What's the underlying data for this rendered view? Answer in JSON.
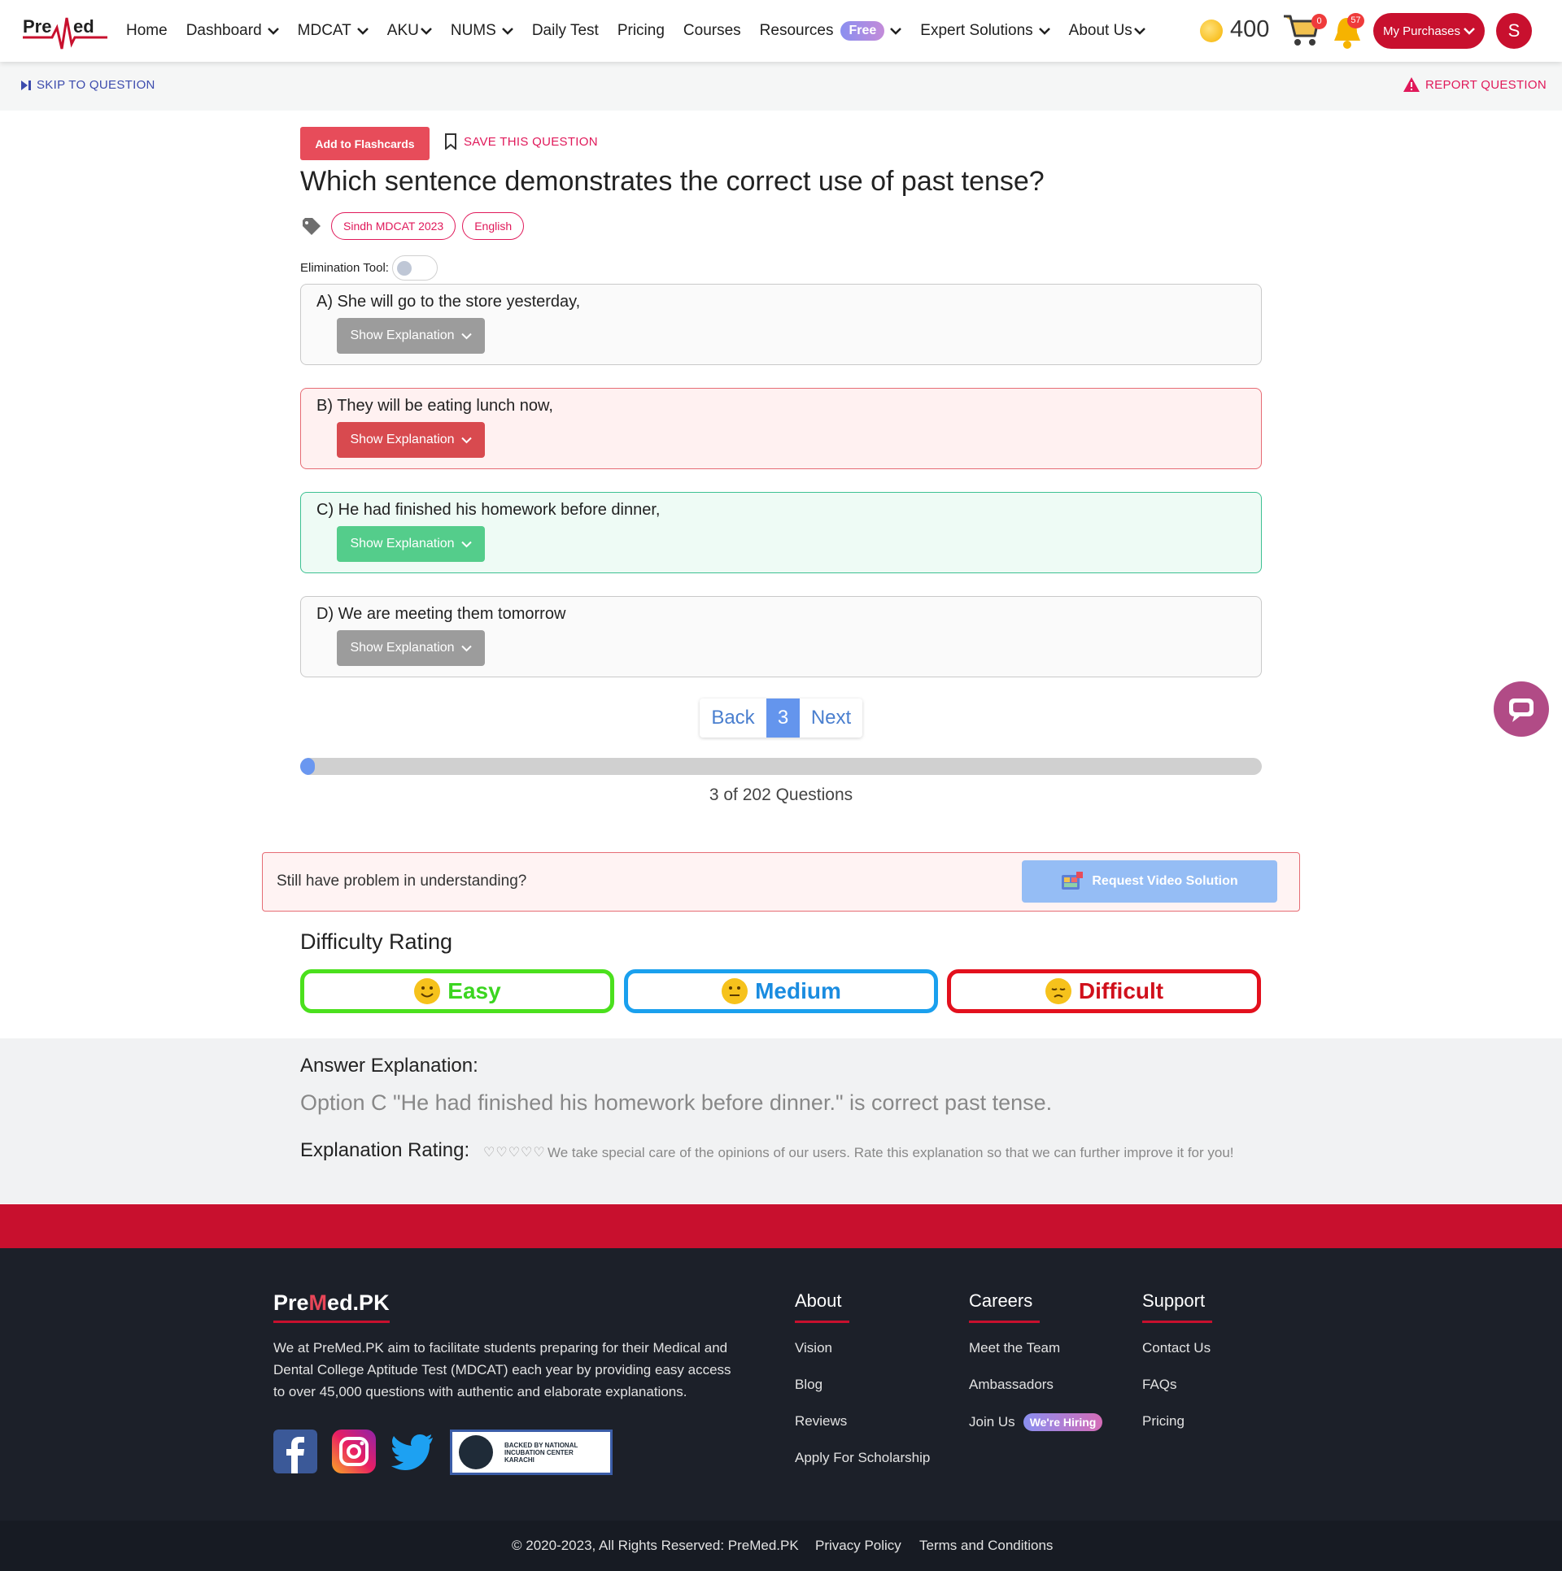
{
  "header": {
    "logo_text": "PreMed",
    "nav": [
      {
        "label": "Home",
        "has_dropdown": false
      },
      {
        "label": "Dashboard",
        "has_dropdown": true
      },
      {
        "label": "MDCAT",
        "has_dropdown": true
      },
      {
        "label": "AKU",
        "has_dropdown": true
      },
      {
        "label": "NUMS",
        "has_dropdown": true
      },
      {
        "label": "Daily Test",
        "has_dropdown": false
      },
      {
        "label": "Pricing",
        "has_dropdown": false
      },
      {
        "label": "Courses",
        "has_dropdown": false
      },
      {
        "label": "Resources",
        "badge": "Free",
        "has_dropdown": true
      },
      {
        "label": "Expert Solutions",
        "has_dropdown": true
      },
      {
        "label": "About Us",
        "has_dropdown": true
      }
    ],
    "coins": "400",
    "cart_count": "0",
    "notification_count": "57",
    "purchases_label": "My Purchases",
    "avatar_initial": "S"
  },
  "subbar": {
    "skip_label": "SKIP TO QUESTION",
    "report_label": "REPORT QUESTION"
  },
  "question": {
    "flashcards_label": "Add to Flashcards",
    "save_label": "SAVE THIS QUESTION",
    "title": "Which sentence demonstrates the correct use of past tense?",
    "tags": [
      "Sindh MDCAT 2023",
      "English"
    ],
    "elimination_label": "Elimination Tool:",
    "elimination_on": false,
    "explanation_button_label": "Show Explanation",
    "options": [
      {
        "text": "A) She will go to the store yesterday,",
        "state": "neutral"
      },
      {
        "text": "B) They will be eating lunch now,",
        "state": "wrong"
      },
      {
        "text": "C) He had finished his homework before dinner,",
        "state": "correct"
      },
      {
        "text": "D) We are meeting them tomorrow",
        "state": "neutral"
      }
    ]
  },
  "pager": {
    "back_label": "Back",
    "current": "3",
    "next_label": "Next"
  },
  "progress": {
    "current": 3,
    "total": 202,
    "label": "3 of 202 Questions"
  },
  "help": {
    "text": "Still have problem in understanding?",
    "button_label": "Request Video Solution"
  },
  "difficulty": {
    "title": "Difficulty Rating",
    "easy_label": "Easy",
    "medium_label": "Medium",
    "difficult_label": "Difficult"
  },
  "answer": {
    "title": "Answer Explanation:",
    "body": "Option C \"He had finished his homework before dinner.\" is correct past tense.",
    "rating_label": "Explanation Rating:",
    "rating_stars": "♡♡♡♡♡",
    "rating_text": "We take special care of the opinions of our users. Rate this explanation so that we can further improve it for you!"
  },
  "footer": {
    "brand_pre": "Pre",
    "brand_m": "M",
    "brand_post": "ed.PK",
    "description": "We at PreMed.PK aim to facilitate students preparing for their Medical and Dental College Aptitude Test (MDCAT) each year by providing easy access to over 45,000 questions with authentic and elaborate explanations.",
    "nic_text": "BACKED BY NATIONAL INCUBATION CENTER KARACHI",
    "about_title": "About",
    "about_links": [
      "Vision",
      "Blog",
      "Reviews",
      "Apply For Scholarship"
    ],
    "careers_title": "Careers",
    "careers_links": [
      "Meet the Team",
      "Ambassadors",
      "Join Us"
    ],
    "hiring_badge": "We're Hiring",
    "support_title": "Support",
    "support_links": [
      "Contact Us",
      "FAQs",
      "Pricing"
    ],
    "copyright": "© 2020-2023, All Rights Reserved: PreMed.PK",
    "privacy": "Privacy Policy",
    "terms": "Terms and Conditions"
  },
  "colors": {
    "brand_red": "#c8102e",
    "accent_pink": "#e0195a",
    "correct_green": "#54cd8b",
    "wrong_red": "#d84a4f",
    "pager_blue": "#6495ed"
  }
}
